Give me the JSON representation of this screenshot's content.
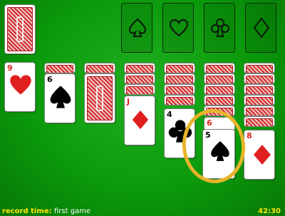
{
  "footer": {
    "record_label": "record time:",
    "record_value": "first game",
    "timer": "42:30"
  },
  "foundations": [
    {
      "suit": "spade",
      "icon": "spade-outline-icon"
    },
    {
      "suit": "heart",
      "icon": "heart-outline-icon"
    },
    {
      "suit": "club",
      "icon": "club-outline-icon"
    },
    {
      "suit": "diamond",
      "icon": "diamond-outline-icon"
    }
  ],
  "tableau": {
    "col1": {
      "rank": "9",
      "suit": "heart"
    },
    "col2": {
      "rank": "6",
      "suit": "spade"
    },
    "col4": {
      "rank": "J",
      "suit": "diamond"
    },
    "col5": {
      "rank": "4",
      "suit": "club"
    },
    "col6_under": {
      "rank": "6",
      "suit": "heart"
    },
    "col6": {
      "rank": "5",
      "suit": "spade"
    },
    "col7": {
      "rank": "8",
      "suit": "diamond"
    }
  },
  "colors": {
    "felt": "#0b9a0b",
    "card_back": "#d22a2a",
    "red_suit": "#e02020",
    "footer_text": "#ffe500",
    "highlight": "#e8b42a"
  }
}
